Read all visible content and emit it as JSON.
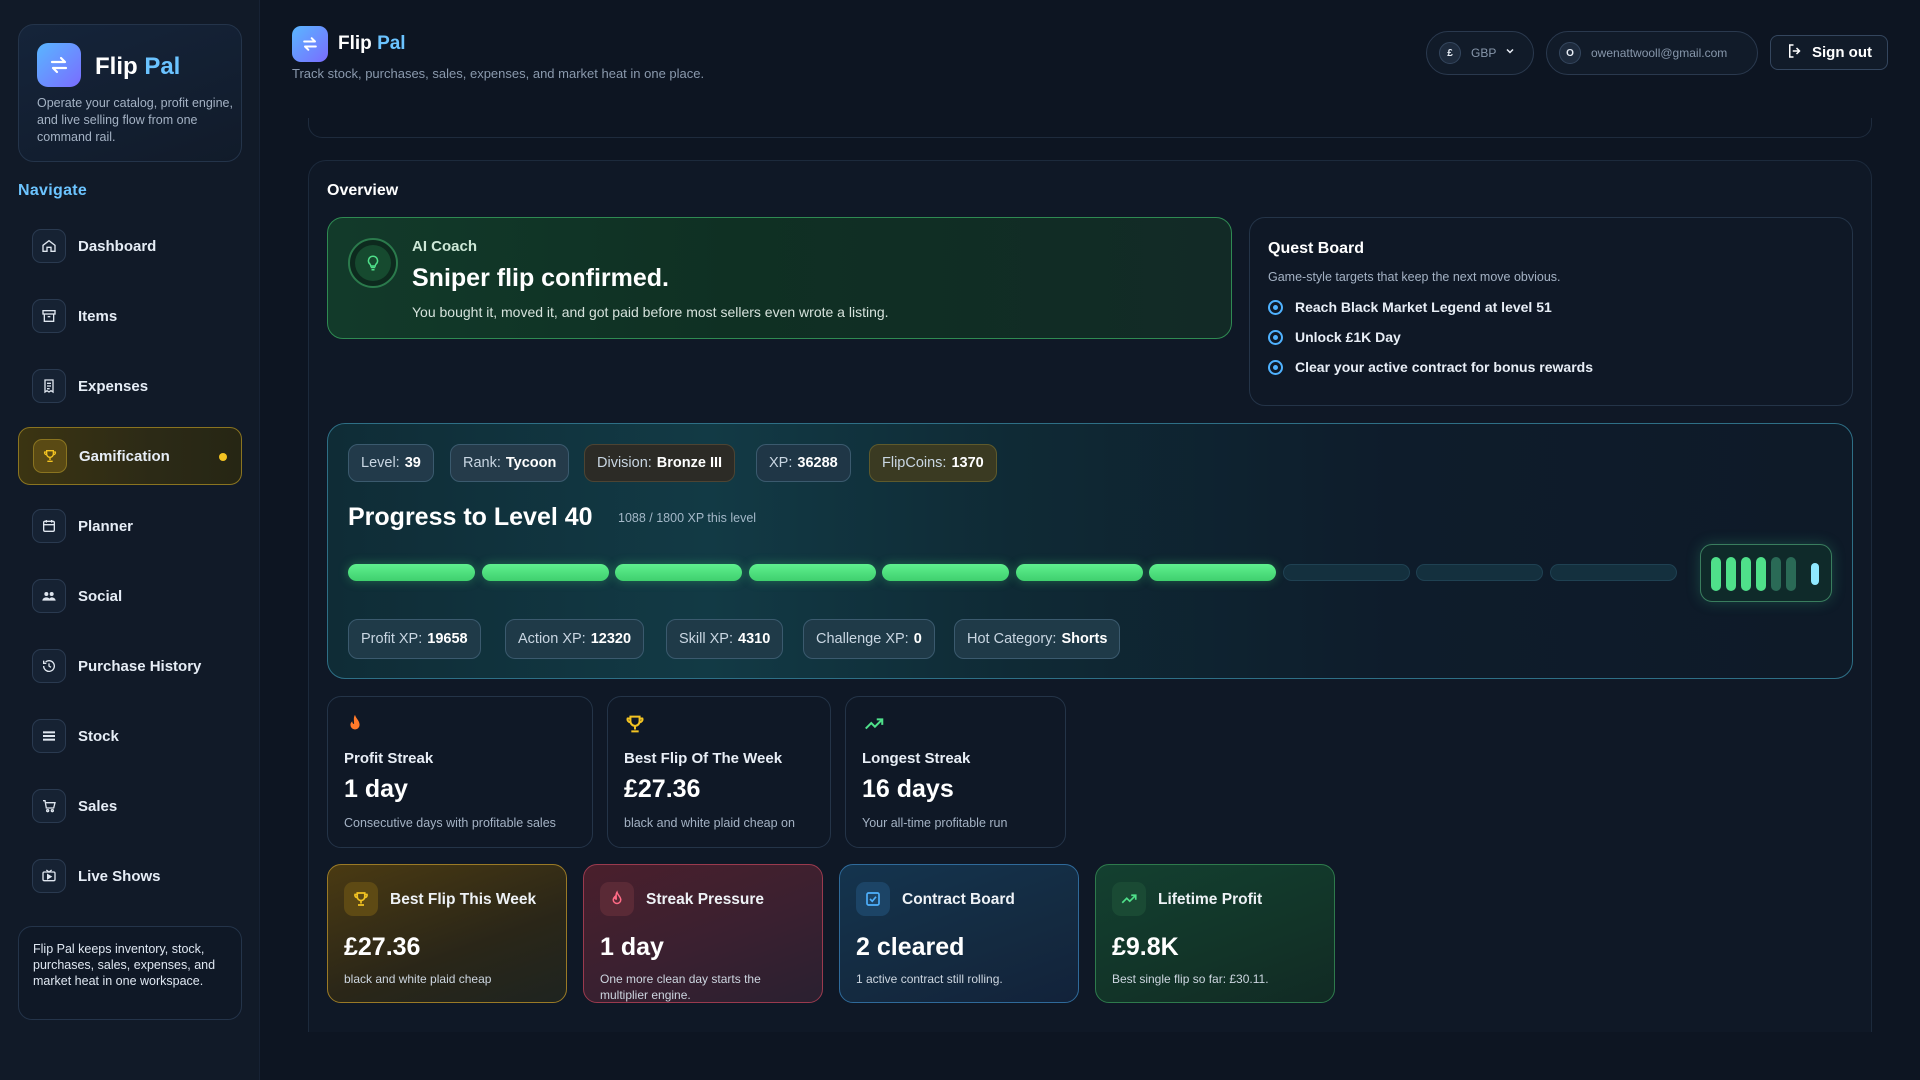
{
  "brand": {
    "name_main": "Flip",
    "name_accent": "Pal",
    "description": "Operate your catalog, profit engine, and live selling flow from one command rail."
  },
  "nav": {
    "heading": "Navigate",
    "items": [
      {
        "label": "Dashboard",
        "icon": "home-icon"
      },
      {
        "label": "Items",
        "icon": "archive-icon"
      },
      {
        "label": "Expenses",
        "icon": "receipt-icon"
      },
      {
        "label": "Gamification",
        "icon": "trophy-icon",
        "active": true
      },
      {
        "label": "Planner",
        "icon": "calendar-icon"
      },
      {
        "label": "Social",
        "icon": "users-icon"
      },
      {
        "label": "Purchase History",
        "icon": "history-icon"
      },
      {
        "label": "Stock",
        "icon": "stack-icon"
      },
      {
        "label": "Sales",
        "icon": "cart-icon"
      },
      {
        "label": "Live Shows",
        "icon": "video-icon"
      }
    ],
    "footer": "Flip Pal keeps inventory, stock, purchases, sales, expenses, and market heat in one workspace."
  },
  "header": {
    "title_main": "Flip",
    "title_accent": "Pal",
    "subtitle": "Track stock, purchases, sales, expenses, and market heat in one place.",
    "currency_symbol": "£",
    "currency": "GBP",
    "user_initial": "O",
    "user_email": "owenattwooll@gmail.com",
    "sign_out": "Sign out"
  },
  "overview": {
    "title": "Overview",
    "coach": {
      "label": "AI Coach",
      "headline": "Sniper flip confirmed.",
      "text": "You bought it, moved it, and got paid before most sellers even wrote a listing."
    },
    "quest": {
      "title": "Quest Board",
      "subtitle": "Game-style targets that keep the next move obvious.",
      "items": [
        "Reach Black Market Legend at level 51",
        "Unlock £1K Day",
        "Clear your active contract for bonus rewards"
      ]
    }
  },
  "progress": {
    "chips": {
      "level_label": "Level:",
      "level": "39",
      "rank_label": "Rank:",
      "rank": "Tycoon",
      "division_label": "Division:",
      "division": "Bronze III",
      "xp_label": "XP:",
      "xp": "36288",
      "coins_label": "FlipCoins:",
      "coins": "1370"
    },
    "title": "Progress to Level 40",
    "subtitle": "1088 / 1800 XP this level",
    "segments_total": 10,
    "segments_filled": 7,
    "breakdown": {
      "profit_label": "Profit XP:",
      "profit": "19658",
      "action_label": "Action XP:",
      "action": "12320",
      "skill_label": "Skill XP:",
      "skill": "4310",
      "challenge_label": "Challenge XP:",
      "challenge": "0",
      "category_label": "Hot Category:",
      "category": "Shorts"
    }
  },
  "stats": [
    {
      "icon": "flame-icon",
      "title": "Profit Streak",
      "value": "1 day",
      "desc": "Consecutive days with profitable sales"
    },
    {
      "icon": "trophy-icon",
      "title": "Best Flip Of The Week",
      "value": "£27.36",
      "desc": "black and white plaid cheap on"
    },
    {
      "icon": "trend-up-icon",
      "title": "Longest Streak",
      "value": "16 days",
      "desc": "Your all-time profitable run"
    }
  ],
  "highlights": [
    {
      "icon": "trophy-icon",
      "title": "Best Flip This Week",
      "value": "£27.36",
      "desc": "black and white plaid cheap"
    },
    {
      "icon": "flame-icon",
      "title": "Streak Pressure",
      "value": "1 day",
      "desc": "One more clean day starts the multiplier engine."
    },
    {
      "icon": "check-square-icon",
      "title": "Contract Board",
      "value": "2 cleared",
      "desc": "1 active contract still rolling."
    },
    {
      "icon": "trend-up-icon",
      "title": "Lifetime Profit",
      "value": "£9.8K",
      "desc": "Best single flip so far: £30.11."
    }
  ],
  "colors": {
    "accent_blue": "#6bc3ff",
    "active_gold": "#f3c322",
    "progress_green": "#4fe08a"
  }
}
